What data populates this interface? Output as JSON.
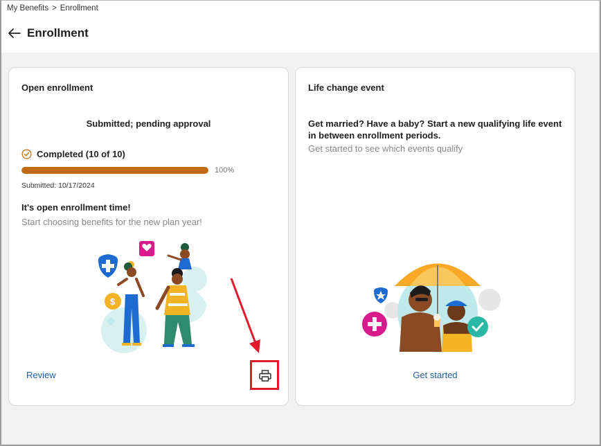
{
  "breadcrumb": {
    "root": "My Benefits",
    "separator": ">",
    "current": "Enrollment"
  },
  "header": {
    "title": "Enrollment",
    "back_icon": "arrow-left-icon"
  },
  "open_enrollment": {
    "title": "Open enrollment",
    "status": "Submitted; pending approval",
    "completed_label": "Completed (10 of 10)",
    "progress": 1.0,
    "progress_text": "100%",
    "submitted": "Submitted: 10/17/2024",
    "promo_heading": "It's open enrollment time!",
    "promo_sub": "Start choosing benefits for the new plan year!",
    "review_label": "Review",
    "print_icon": "printer-icon"
  },
  "life_change": {
    "title": "Life change event",
    "heading": "Get married? Have a baby? Start a new qualifying life event in between enrollment periods.",
    "sub": "Get started to see which events qualify",
    "cta": "Get started"
  },
  "colors": {
    "accent_link": "#1f5fa0",
    "progress": "#c26a14",
    "annotation": "#e0192b"
  }
}
